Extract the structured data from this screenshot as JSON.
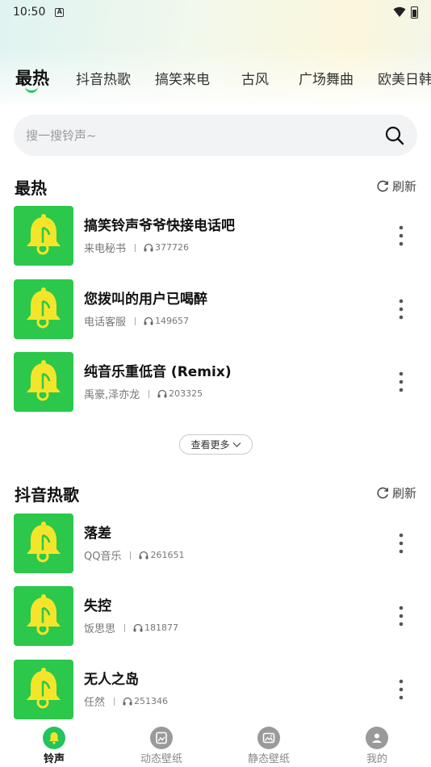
{
  "status_bar": {
    "time": "10:50",
    "notification_letter": "A"
  },
  "tabs": [
    {
      "label": "最热",
      "active": true
    },
    {
      "label": "抖音热歌"
    },
    {
      "label": "搞笑来电"
    },
    {
      "label": "古风"
    },
    {
      "label": "广场舞曲"
    },
    {
      "label": "欧美日韩"
    }
  ],
  "search": {
    "placeholder": "搜一搜铃声~"
  },
  "sections": [
    {
      "title": "最热",
      "refresh_label": "刷新",
      "items": [
        {
          "title": "搞笑铃声爷爷快接电话吧",
          "artist": "来电秘书",
          "plays": "377726"
        },
        {
          "title": "您拨叫的用户已喝醉",
          "artist": "电话客服",
          "plays": "149657"
        },
        {
          "title": "纯音乐重低音 (Remix)",
          "artist": "禹豪,泽亦龙",
          "plays": "203325"
        }
      ],
      "see_more_label": "查看更多"
    },
    {
      "title": "抖音热歌",
      "refresh_label": "刷新",
      "items": [
        {
          "title": "落差",
          "artist": "QQ音乐",
          "plays": "261651"
        },
        {
          "title": "失控",
          "artist": "饭思思",
          "plays": "181877"
        },
        {
          "title": "无人之岛",
          "artist": "任然",
          "plays": "251346"
        }
      ]
    }
  ],
  "bottom_nav": [
    {
      "label": "铃声",
      "icon": "ringtone-icon",
      "active": true
    },
    {
      "label": "动态壁纸",
      "icon": "live-wallpaper-icon"
    },
    {
      "label": "静态壁纸",
      "icon": "static-wallpaper-icon"
    },
    {
      "label": "我的",
      "icon": "profile-icon"
    }
  ],
  "colors": {
    "accent": "#22c45c",
    "cover_bg": "#2bc84b",
    "bell": "#f5e52a"
  }
}
